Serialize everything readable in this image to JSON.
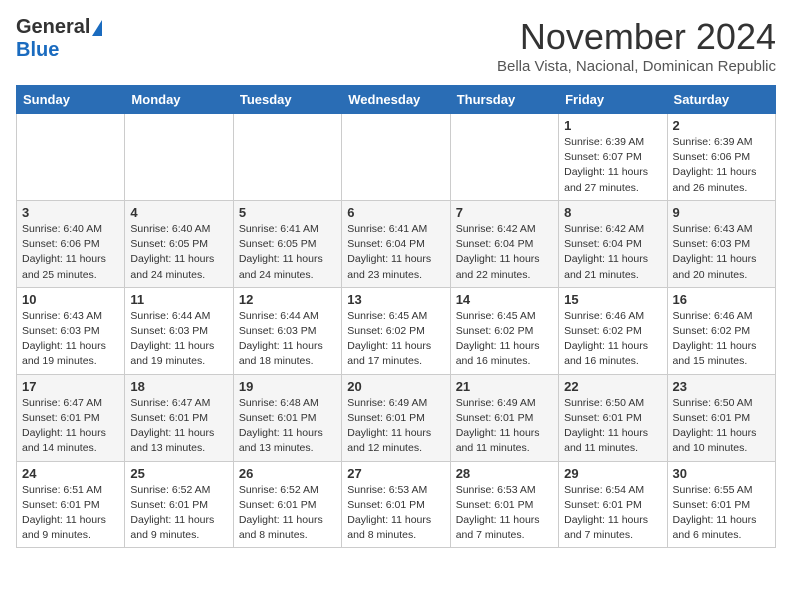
{
  "header": {
    "logo_general": "General",
    "logo_blue": "Blue",
    "month": "November 2024",
    "location": "Bella Vista, Nacional, Dominican Republic"
  },
  "weekdays": [
    "Sunday",
    "Monday",
    "Tuesday",
    "Wednesday",
    "Thursday",
    "Friday",
    "Saturday"
  ],
  "weeks": [
    [
      {
        "day": "",
        "info": ""
      },
      {
        "day": "",
        "info": ""
      },
      {
        "day": "",
        "info": ""
      },
      {
        "day": "",
        "info": ""
      },
      {
        "day": "",
        "info": ""
      },
      {
        "day": "1",
        "info": "Sunrise: 6:39 AM\nSunset: 6:07 PM\nDaylight: 11 hours\nand 27 minutes."
      },
      {
        "day": "2",
        "info": "Sunrise: 6:39 AM\nSunset: 6:06 PM\nDaylight: 11 hours\nand 26 minutes."
      }
    ],
    [
      {
        "day": "3",
        "info": "Sunrise: 6:40 AM\nSunset: 6:06 PM\nDaylight: 11 hours\nand 25 minutes."
      },
      {
        "day": "4",
        "info": "Sunrise: 6:40 AM\nSunset: 6:05 PM\nDaylight: 11 hours\nand 24 minutes."
      },
      {
        "day": "5",
        "info": "Sunrise: 6:41 AM\nSunset: 6:05 PM\nDaylight: 11 hours\nand 24 minutes."
      },
      {
        "day": "6",
        "info": "Sunrise: 6:41 AM\nSunset: 6:04 PM\nDaylight: 11 hours\nand 23 minutes."
      },
      {
        "day": "7",
        "info": "Sunrise: 6:42 AM\nSunset: 6:04 PM\nDaylight: 11 hours\nand 22 minutes."
      },
      {
        "day": "8",
        "info": "Sunrise: 6:42 AM\nSunset: 6:04 PM\nDaylight: 11 hours\nand 21 minutes."
      },
      {
        "day": "9",
        "info": "Sunrise: 6:43 AM\nSunset: 6:03 PM\nDaylight: 11 hours\nand 20 minutes."
      }
    ],
    [
      {
        "day": "10",
        "info": "Sunrise: 6:43 AM\nSunset: 6:03 PM\nDaylight: 11 hours\nand 19 minutes."
      },
      {
        "day": "11",
        "info": "Sunrise: 6:44 AM\nSunset: 6:03 PM\nDaylight: 11 hours\nand 19 minutes."
      },
      {
        "day": "12",
        "info": "Sunrise: 6:44 AM\nSunset: 6:03 PM\nDaylight: 11 hours\nand 18 minutes."
      },
      {
        "day": "13",
        "info": "Sunrise: 6:45 AM\nSunset: 6:02 PM\nDaylight: 11 hours\nand 17 minutes."
      },
      {
        "day": "14",
        "info": "Sunrise: 6:45 AM\nSunset: 6:02 PM\nDaylight: 11 hours\nand 16 minutes."
      },
      {
        "day": "15",
        "info": "Sunrise: 6:46 AM\nSunset: 6:02 PM\nDaylight: 11 hours\nand 16 minutes."
      },
      {
        "day": "16",
        "info": "Sunrise: 6:46 AM\nSunset: 6:02 PM\nDaylight: 11 hours\nand 15 minutes."
      }
    ],
    [
      {
        "day": "17",
        "info": "Sunrise: 6:47 AM\nSunset: 6:01 PM\nDaylight: 11 hours\nand 14 minutes."
      },
      {
        "day": "18",
        "info": "Sunrise: 6:47 AM\nSunset: 6:01 PM\nDaylight: 11 hours\nand 13 minutes."
      },
      {
        "day": "19",
        "info": "Sunrise: 6:48 AM\nSunset: 6:01 PM\nDaylight: 11 hours\nand 13 minutes."
      },
      {
        "day": "20",
        "info": "Sunrise: 6:49 AM\nSunset: 6:01 PM\nDaylight: 11 hours\nand 12 minutes."
      },
      {
        "day": "21",
        "info": "Sunrise: 6:49 AM\nSunset: 6:01 PM\nDaylight: 11 hours\nand 11 minutes."
      },
      {
        "day": "22",
        "info": "Sunrise: 6:50 AM\nSunset: 6:01 PM\nDaylight: 11 hours\nand 11 minutes."
      },
      {
        "day": "23",
        "info": "Sunrise: 6:50 AM\nSunset: 6:01 PM\nDaylight: 11 hours\nand 10 minutes."
      }
    ],
    [
      {
        "day": "24",
        "info": "Sunrise: 6:51 AM\nSunset: 6:01 PM\nDaylight: 11 hours\nand 9 minutes."
      },
      {
        "day": "25",
        "info": "Sunrise: 6:52 AM\nSunset: 6:01 PM\nDaylight: 11 hours\nand 9 minutes."
      },
      {
        "day": "26",
        "info": "Sunrise: 6:52 AM\nSunset: 6:01 PM\nDaylight: 11 hours\nand 8 minutes."
      },
      {
        "day": "27",
        "info": "Sunrise: 6:53 AM\nSunset: 6:01 PM\nDaylight: 11 hours\nand 8 minutes."
      },
      {
        "day": "28",
        "info": "Sunrise: 6:53 AM\nSunset: 6:01 PM\nDaylight: 11 hours\nand 7 minutes."
      },
      {
        "day": "29",
        "info": "Sunrise: 6:54 AM\nSunset: 6:01 PM\nDaylight: 11 hours\nand 7 minutes."
      },
      {
        "day": "30",
        "info": "Sunrise: 6:55 AM\nSunset: 6:01 PM\nDaylight: 11 hours\nand 6 minutes."
      }
    ]
  ]
}
